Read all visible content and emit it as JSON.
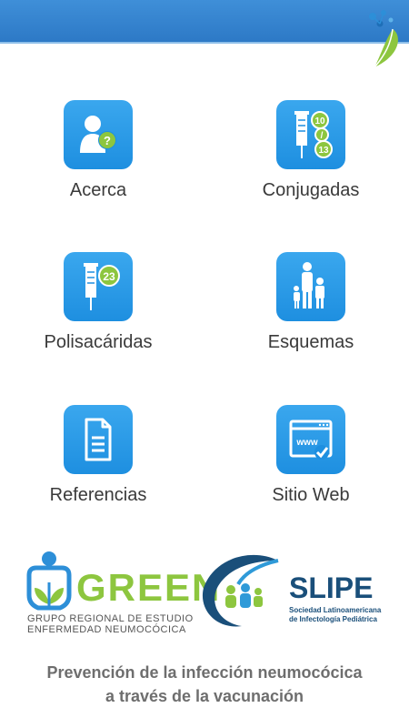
{
  "menu": [
    {
      "label": "Acerca",
      "icon": "user-question-icon"
    },
    {
      "label": "Conjugadas",
      "icon": "syringe-numbers-icon"
    },
    {
      "label": "Polisacáridas",
      "icon": "syringe-23-icon"
    },
    {
      "label": "Esquemas",
      "icon": "family-icon"
    },
    {
      "label": "Referencias",
      "icon": "document-icon"
    },
    {
      "label": "Sitio Web",
      "icon": "web-browser-icon"
    }
  ],
  "conjugadas_numbers": [
    "10",
    "/",
    "13"
  ],
  "polisacaridas_number": "23",
  "web_text": "www",
  "logos": {
    "green": {
      "word": "GREEN",
      "line1": "GRUPO REGIONAL DE ESTUDIO",
      "line2": "ENFERMEDAD NEUMOCÓCICA"
    },
    "slipe": {
      "word": "SLIPE",
      "line1": "Sociedad Latinoamericana",
      "line2": "de Infectología Pediátrica"
    }
  },
  "tagline": {
    "line1": "Prevención de la infección neumocócica",
    "line2": "a través de la vacunación"
  },
  "colors": {
    "header": "#2d79c6",
    "tile": "#1e8fe0",
    "green": "#8dc63f",
    "slipe": "#1a4f7a"
  }
}
